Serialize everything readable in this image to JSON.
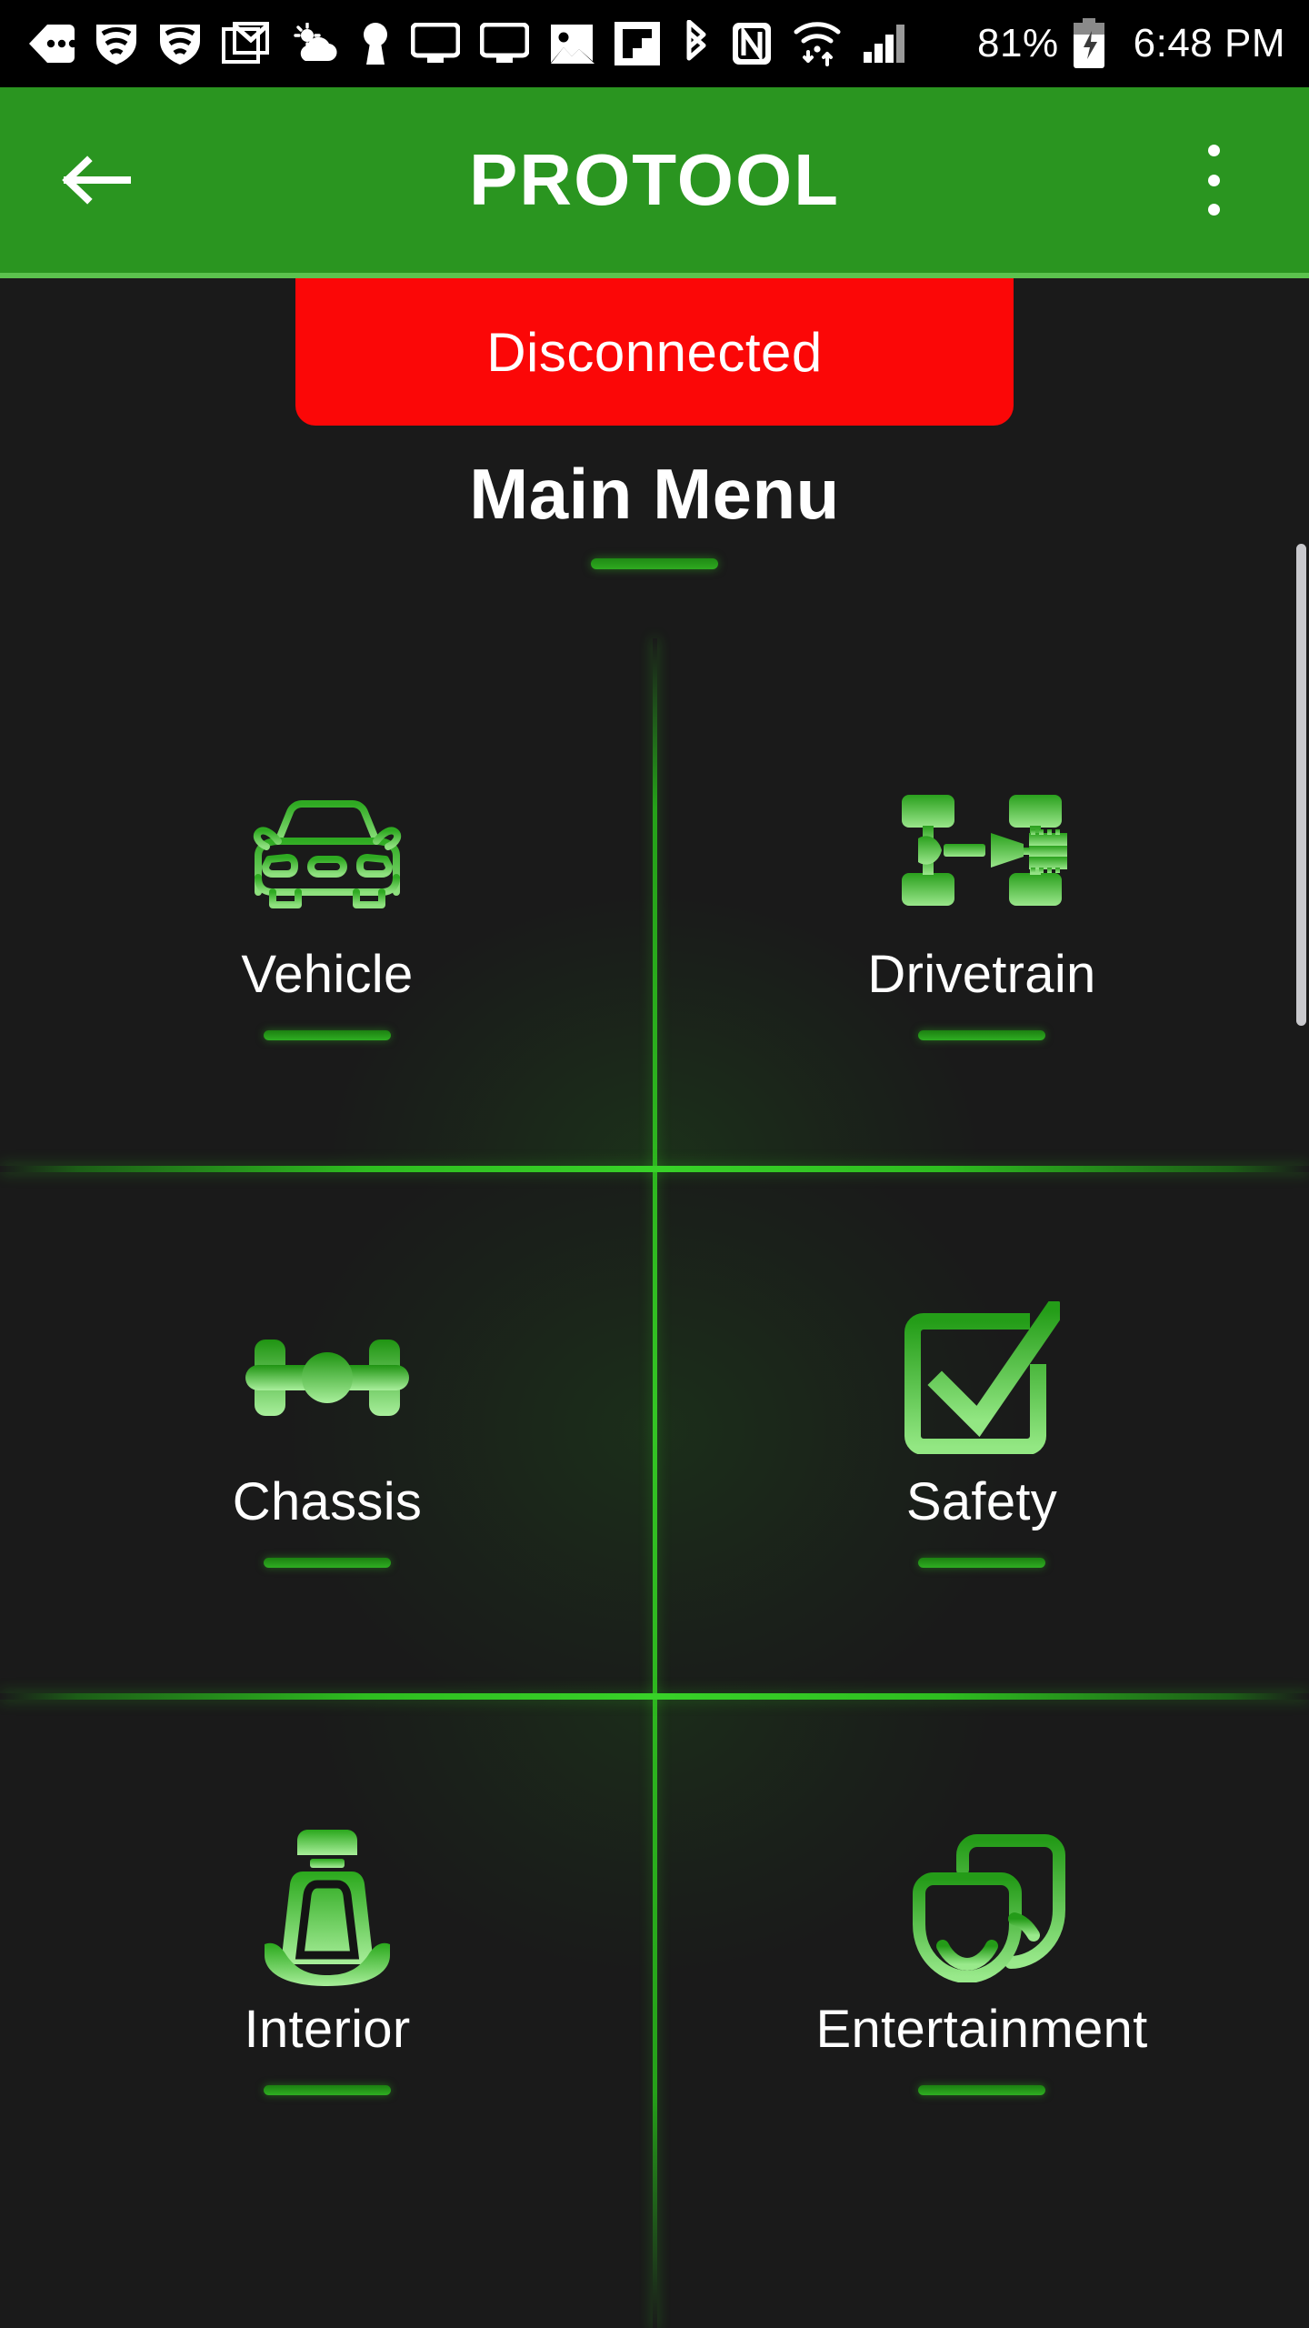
{
  "status_bar": {
    "icons": [
      {
        "name": "messages-icon"
      },
      {
        "name": "wifi-shield-icon"
      },
      {
        "name": "wifi-shield-icon-2"
      },
      {
        "name": "gmail-icon"
      },
      {
        "name": "weather-partly-cloudy-icon"
      },
      {
        "name": "keyhole-icon"
      },
      {
        "name": "cast-screen-icon"
      },
      {
        "name": "cast-screen-icon-2"
      },
      {
        "name": "photo-image-icon"
      },
      {
        "name": "flipboard-icon"
      },
      {
        "name": "bluetooth-icon"
      },
      {
        "name": "nfc-icon"
      },
      {
        "name": "wifi-transfer-icon"
      },
      {
        "name": "cellular-signal-icon"
      }
    ],
    "battery_percent": "81%",
    "battery_state": "charging",
    "time": "6:48 PM"
  },
  "app_bar": {
    "title": "PROTOOL",
    "back_icon": "arrow-left-icon",
    "overflow_icon": "more-vertical-icon",
    "background_color": "#2a9520",
    "accent_underline_color": "#5cc24e"
  },
  "connection": {
    "status_label": "Disconnected",
    "status_color": "#fb0707",
    "text_color": "#ffffff"
  },
  "page": {
    "title": "Main Menu",
    "background_color": "#1a1a1a",
    "accent_color": "#2fae22"
  },
  "menu": {
    "items": [
      {
        "label": "Vehicle",
        "icon": "car-front-icon"
      },
      {
        "label": "Drivetrain",
        "icon": "drivetrain-axle-icon"
      },
      {
        "label": "Chassis",
        "icon": "chassis-axle-icon"
      },
      {
        "label": "Safety",
        "icon": "checkbox-check-icon"
      },
      {
        "label": "Interior",
        "icon": "car-seat-icon"
      },
      {
        "label": "Entertainment",
        "icon": "multimedia-screens-icon"
      }
    ]
  },
  "scrollbar": {
    "thumb_color": "#c9c9cd"
  }
}
